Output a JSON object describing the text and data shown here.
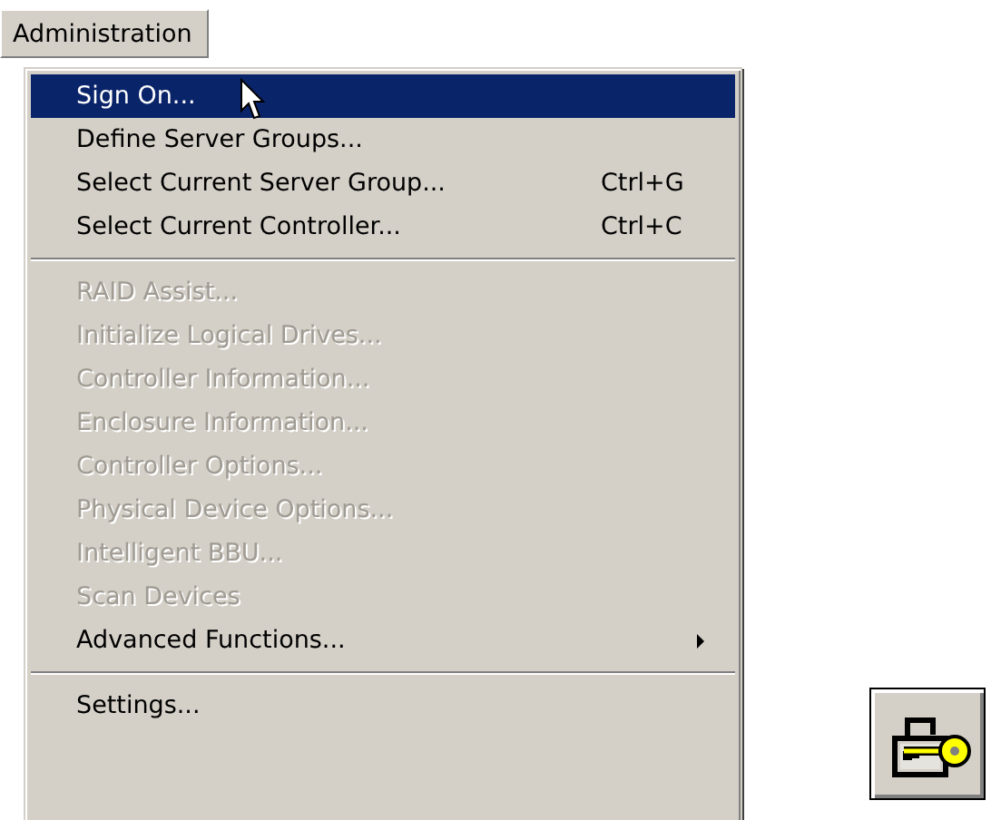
{
  "menu_bar": {
    "title": "Administration"
  },
  "menu": {
    "entries": [
      {
        "kind": "item",
        "label": "Sign On...",
        "selected": true,
        "disabled": false,
        "submenu": false
      },
      {
        "kind": "item",
        "label": "Define Server Groups...",
        "selected": false,
        "disabled": false,
        "submenu": false
      },
      {
        "kind": "item",
        "label": "Select Current Server Group...",
        "shortcut": "Ctrl+G",
        "selected": false,
        "disabled": false,
        "submenu": false
      },
      {
        "kind": "item",
        "label": "Select Current Controller...",
        "shortcut": "Ctrl+C",
        "selected": false,
        "disabled": false,
        "submenu": false
      },
      {
        "kind": "separator"
      },
      {
        "kind": "item",
        "label": "RAID Assist...",
        "selected": false,
        "disabled": true,
        "submenu": false
      },
      {
        "kind": "item",
        "label": "Initialize Logical Drives...",
        "selected": false,
        "disabled": true,
        "submenu": false
      },
      {
        "kind": "item",
        "label": "Controller Information...",
        "selected": false,
        "disabled": true,
        "submenu": false
      },
      {
        "kind": "item",
        "label": "Enclosure Information...",
        "selected": false,
        "disabled": true,
        "submenu": false
      },
      {
        "kind": "item",
        "label": "Controller Options...",
        "selected": false,
        "disabled": true,
        "submenu": false
      },
      {
        "kind": "item",
        "label": "Physical Device Options...",
        "selected": false,
        "disabled": true,
        "submenu": false
      },
      {
        "kind": "item",
        "label": "Intelligent BBU...",
        "selected": false,
        "disabled": true,
        "submenu": false
      },
      {
        "kind": "item",
        "label": "Scan Devices",
        "selected": false,
        "disabled": true,
        "submenu": false
      },
      {
        "kind": "item",
        "label": "Advanced Functions...",
        "selected": false,
        "disabled": false,
        "submenu": true
      },
      {
        "kind": "separator"
      },
      {
        "kind": "item",
        "label": "Settings...",
        "selected": false,
        "disabled": false,
        "submenu": false
      }
    ]
  }
}
